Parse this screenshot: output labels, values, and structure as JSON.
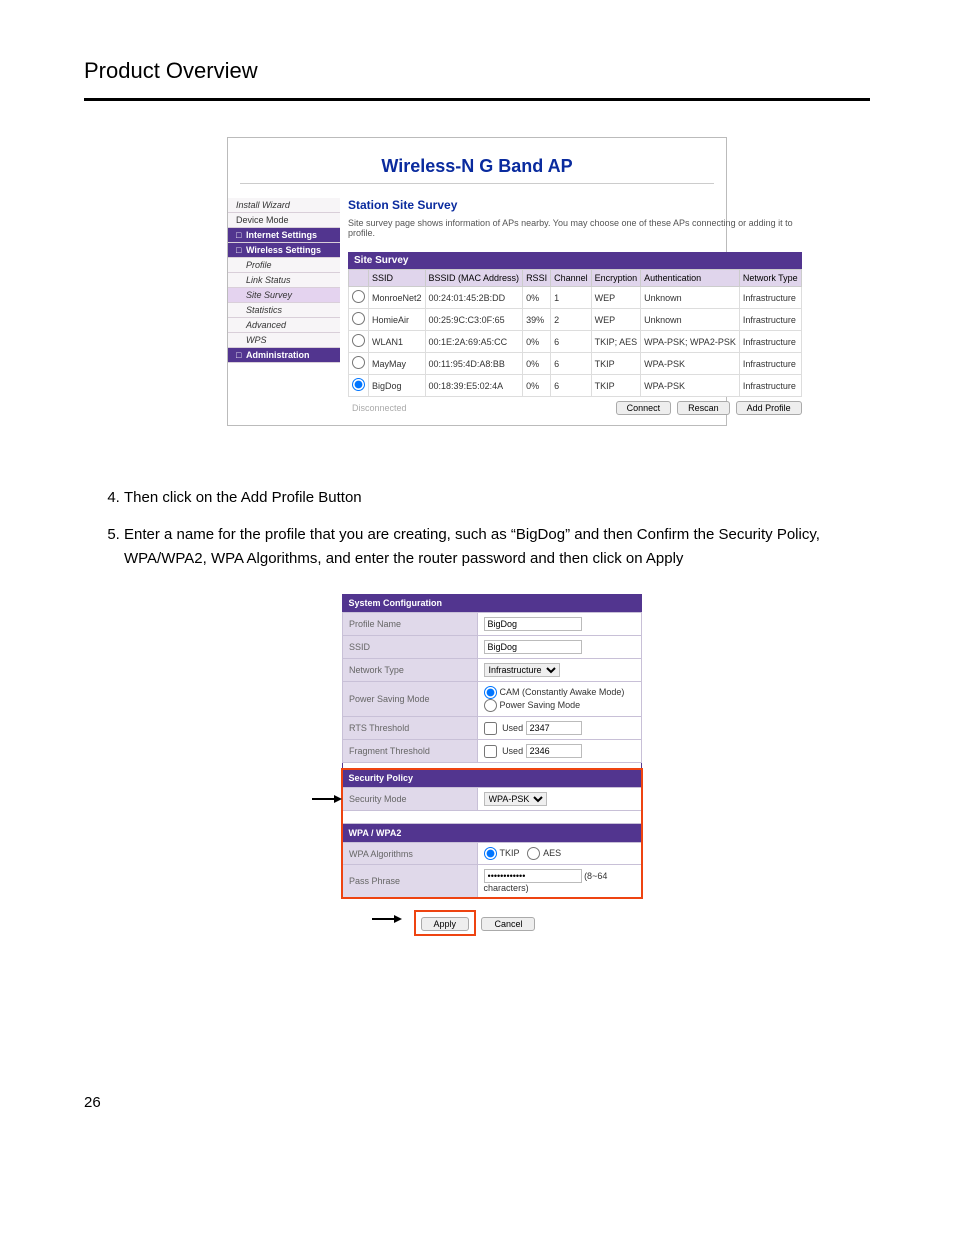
{
  "page_title": "Product Overview",
  "page_number": "26",
  "router": {
    "banner": "Wireless-N G Band AP",
    "nav": [
      {
        "label": "Install Wizard",
        "cls": "italic"
      },
      {
        "label": "Device Mode",
        "cls": ""
      },
      {
        "label": "Internet Settings",
        "cls": "group",
        "icon": "□"
      },
      {
        "label": "Wireless Settings",
        "cls": "group",
        "icon": "□"
      },
      {
        "label": "Profile",
        "cls": "sub"
      },
      {
        "label": "Link Status",
        "cls": "sub"
      },
      {
        "label": "Site Survey",
        "cls": "highlight sub"
      },
      {
        "label": "Statistics",
        "cls": "sub"
      },
      {
        "label": "Advanced",
        "cls": "sub"
      },
      {
        "label": "WPS",
        "cls": "sub"
      },
      {
        "label": "Administration",
        "cls": "group",
        "icon": "□"
      }
    ],
    "station_title": "Station Site Survey",
    "station_desc": "Site survey page shows information of APs nearby. You may choose one of these APs connecting or adding it to profile.",
    "survey_header": "Site Survey",
    "columns": [
      "",
      "SSID",
      "BSSID (MAC Address)",
      "RSSI",
      "Channel",
      "Encryption",
      "Authentication",
      "Network Type"
    ],
    "rows": [
      {
        "sel": false,
        "ssid": "MonroeNet2",
        "bssid": "00:24:01:45:2B:DD",
        "rssi": "0%",
        "ch": "1",
        "enc": "WEP",
        "auth": "Unknown",
        "ntype": "Infrastructure"
      },
      {
        "sel": false,
        "ssid": "HomieAir",
        "bssid": "00:25:9C:C3:0F:65",
        "rssi": "39%",
        "ch": "2",
        "enc": "WEP",
        "auth": "Unknown",
        "ntype": "Infrastructure"
      },
      {
        "sel": false,
        "ssid": "WLAN1",
        "bssid": "00:1E:2A:69:A5:CC",
        "rssi": "0%",
        "ch": "6",
        "enc": "TKIP; AES",
        "auth": "WPA-PSK; WPA2-PSK",
        "ntype": "Infrastructure"
      },
      {
        "sel": false,
        "ssid": "MayMay",
        "bssid": "00:11:95:4D:A8:BB",
        "rssi": "0%",
        "ch": "6",
        "enc": "TKIP",
        "auth": "WPA-PSK",
        "ntype": "Infrastructure"
      },
      {
        "sel": true,
        "ssid": "BigDog",
        "bssid": "00:18:39:E5:02:4A",
        "rssi": "0%",
        "ch": "6",
        "enc": "TKIP",
        "auth": "WPA-PSK",
        "ntype": "Infrastructure"
      }
    ],
    "footer_status": "Disconnected",
    "buttons": {
      "connect": "Connect",
      "rescan": "Rescan",
      "add_profile": "Add Profile"
    }
  },
  "instructions": [
    "Then click on the Add Profile Button",
    "Enter a name for the profile that you are creating, such as “BigDog” and then Confirm the Security Policy, WPA/WPA2, WPA Algorithms, and enter the router password and then click on Apply"
  ],
  "config": {
    "sections": {
      "sysconf": "System Configuration",
      "secpol": "Security Policy",
      "wpa": "WPA / WPA2"
    },
    "labels": {
      "profile_name": "Profile Name",
      "ssid": "SSID",
      "net_type": "Network Type",
      "pwr_mode": "Power Saving Mode",
      "rts": "RTS Threshold",
      "frag": "Fragment Threshold",
      "sec_mode": "Security Mode",
      "wpa_alg": "WPA Algorithms",
      "pass": "Pass Phrase"
    },
    "values": {
      "profile_name": "BigDog",
      "ssid": "BigDog",
      "net_type": "Infrastructure",
      "pwr_cam": "CAM (Constantly Awake Mode)",
      "pwr_psm": "Power Saving Mode",
      "used": "Used",
      "rts_val": "2347",
      "frag_val": "2346",
      "sec_mode_val": "WPA-PSK",
      "tkip": "TKIP",
      "aes": "AES",
      "pass_val": "••••••••••••",
      "pass_hint": "(8~64 characters)"
    },
    "buttons": {
      "apply": "Apply",
      "cancel": "Cancel"
    }
  }
}
